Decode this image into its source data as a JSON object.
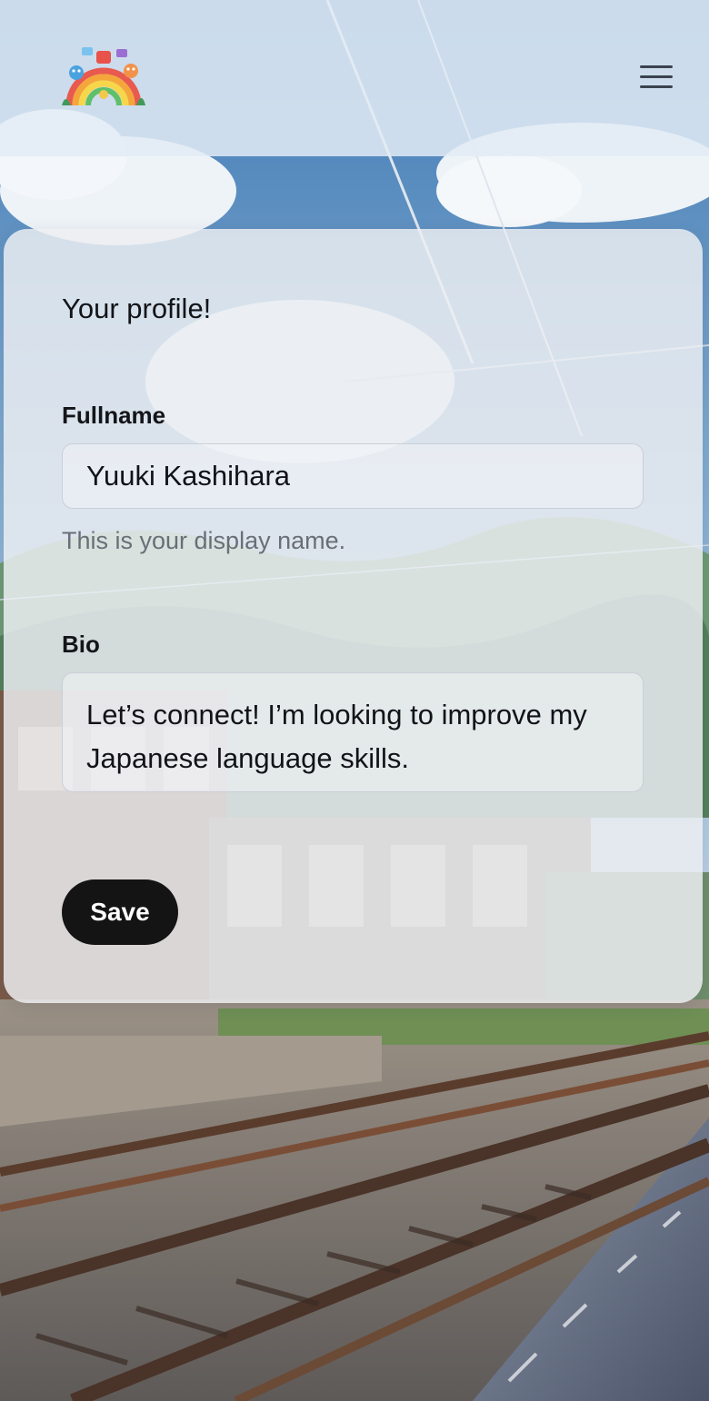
{
  "header": {
    "logo_icon": "rainbow-characters-logo",
    "menu_icon": "hamburger-menu-icon"
  },
  "profile_form": {
    "title": "Your profile!",
    "fullname": {
      "label": "Fullname",
      "value": "Yuuki Kashihara",
      "helper": "This is your display name."
    },
    "bio": {
      "label": "Bio",
      "value": "Let’s connect! I’m looking to improve my Japanese language skills."
    },
    "save_label": "Save"
  },
  "colors": {
    "button_background": "#141414",
    "button_text": "#ffffff",
    "helper_text": "#6a6e76",
    "header_background": "#e2ebf4"
  }
}
